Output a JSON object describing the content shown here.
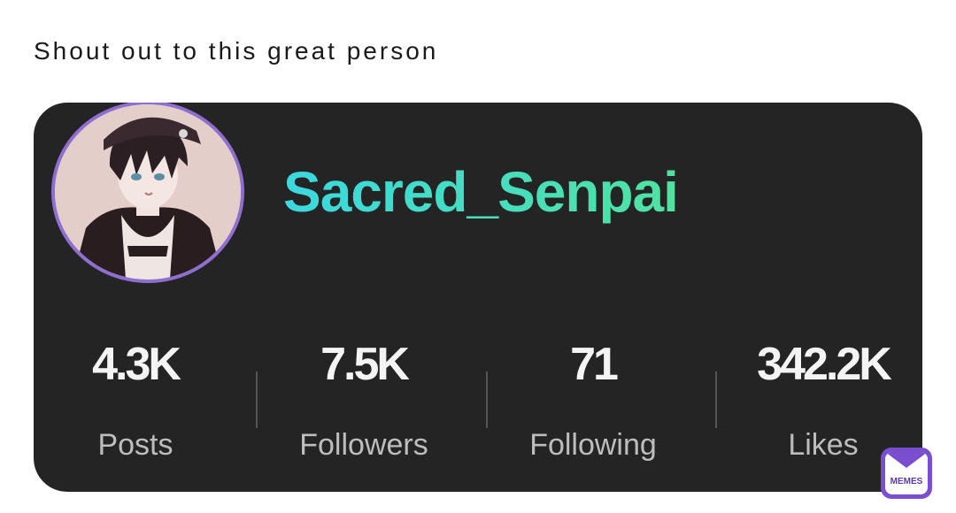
{
  "caption": "Shout out to this great person",
  "profile": {
    "username": "Sacred_Senpai",
    "avatar_icon": "anime-avatar-icon",
    "avatar_border_color": "#8e6fd1"
  },
  "stats": [
    {
      "value": "4.3K",
      "label": "Posts"
    },
    {
      "value": "7.5K",
      "label": "Followers"
    },
    {
      "value": "71",
      "label": "Following"
    },
    {
      "value": "342.2K",
      "label": "Likes"
    }
  ],
  "watermark": {
    "text": "MEMES",
    "icon": "envelope-icon",
    "color": "#7a4fcf"
  },
  "colors": {
    "card_background": "#242424",
    "username_gradient_start": "#3bd8e0",
    "username_gradient_end": "#4fe3a0"
  }
}
